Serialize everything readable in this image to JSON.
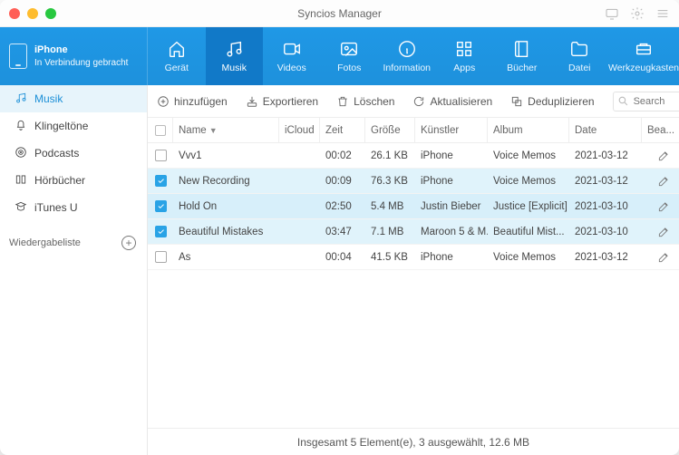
{
  "title": "Syncios Manager",
  "device": {
    "label": "iPhone",
    "status": "In Verbindung gebracht"
  },
  "tabs": [
    {
      "id": "geraet",
      "label": "Gerät"
    },
    {
      "id": "musik",
      "label": "Musik"
    },
    {
      "id": "videos",
      "label": "Videos"
    },
    {
      "id": "fotos",
      "label": "Fotos"
    },
    {
      "id": "info",
      "label": "Information"
    },
    {
      "id": "apps",
      "label": "Apps"
    },
    {
      "id": "buecher",
      "label": "Bücher"
    },
    {
      "id": "datei",
      "label": "Datei"
    },
    {
      "id": "tools",
      "label": "Werkzeugkasten"
    }
  ],
  "sidebar": {
    "items": [
      {
        "id": "musik",
        "label": "Musik"
      },
      {
        "id": "klingel",
        "label": "Klingeltöne"
      },
      {
        "id": "podcasts",
        "label": "Podcasts"
      },
      {
        "id": "hoerb",
        "label": "Hörbücher"
      },
      {
        "id": "itunesu",
        "label": "iTunes U"
      }
    ],
    "playlist": "Wiedergabeliste"
  },
  "toolbar": {
    "add": "hinzufügen",
    "export": "Exportieren",
    "del": "Löschen",
    "refresh": "Aktualisieren",
    "dedup": "Deduplizieren",
    "search_placeholder": "Search"
  },
  "columns": {
    "name": "Name",
    "icloud": "iCloud",
    "zeit": "Zeit",
    "size": "Größe",
    "artist": "Künstler",
    "album": "Album",
    "date": "Date",
    "action": "Bea..."
  },
  "rows": [
    {
      "sel": false,
      "name": "Vvv1",
      "zeit": "00:02",
      "size": "26.1 KB",
      "artist": "iPhone",
      "album": "Voice Memos",
      "date": "2021-03-12"
    },
    {
      "sel": true,
      "name": "New Recording",
      "zeit": "00:09",
      "size": "76.3 KB",
      "artist": "iPhone",
      "album": "Voice Memos",
      "date": "2021-03-12"
    },
    {
      "sel": true,
      "name": "Hold On",
      "zeit": "02:50",
      "size": "5.4 MB",
      "artist": "Justin Bieber",
      "album": "Justice [Explicit]",
      "date": "2021-03-10"
    },
    {
      "sel": true,
      "name": "Beautiful Mistakes",
      "zeit": "03:47",
      "size": "7.1 MB",
      "artist": "Maroon 5 & M...",
      "album": "Beautiful Mist...",
      "date": "2021-03-10"
    },
    {
      "sel": false,
      "name": "As",
      "zeit": "00:04",
      "size": "41.5 KB",
      "artist": "iPhone",
      "album": "Voice Memos",
      "date": "2021-03-12"
    }
  ],
  "status": "Insgesamt 5 Element(e), 3 ausgewählt, 12.6 MB"
}
